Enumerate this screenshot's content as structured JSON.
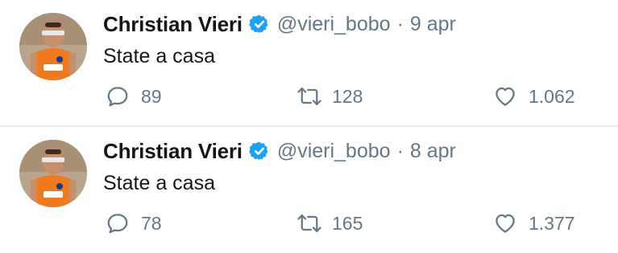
{
  "tweets": [
    {
      "author_name": "Christian Vieri",
      "handle": "@vieri_bobo",
      "separator": "·",
      "date": "9 apr",
      "text": "State a casa",
      "replies": "89",
      "retweets": "128",
      "likes": "1.062"
    },
    {
      "author_name": "Christian Vieri",
      "handle": "@vieri_bobo",
      "separator": "·",
      "date": "8 apr",
      "text": "State a casa",
      "replies": "78",
      "retweets": "165",
      "likes": "1.377"
    }
  ],
  "colors": {
    "verified_badge": "#1da1f2",
    "secondary_text": "#657786",
    "primary_text": "#14171a",
    "divider": "#e6ecf0"
  },
  "icons": {
    "verified": "verified-badge-icon",
    "reply": "reply-icon",
    "retweet": "retweet-icon",
    "like": "like-icon"
  }
}
